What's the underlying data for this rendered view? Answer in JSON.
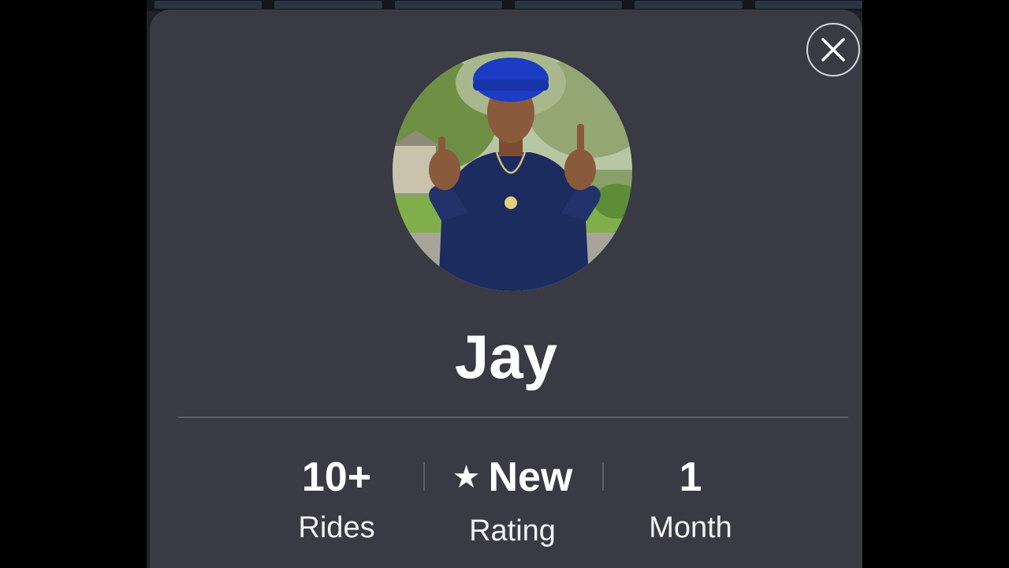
{
  "profile": {
    "name": "Jay",
    "close_icon": "close-icon",
    "avatar_icon": "profile-photo"
  },
  "stats": [
    {
      "value": "10+",
      "label": "Rides"
    },
    {
      "value": "New",
      "label": "Rating",
      "icon": "star-icon"
    },
    {
      "value": "1",
      "label": "Month"
    }
  ],
  "colors": {
    "sheet": "#393a44",
    "text": "#ffffff",
    "divider": "#5d5e68"
  }
}
